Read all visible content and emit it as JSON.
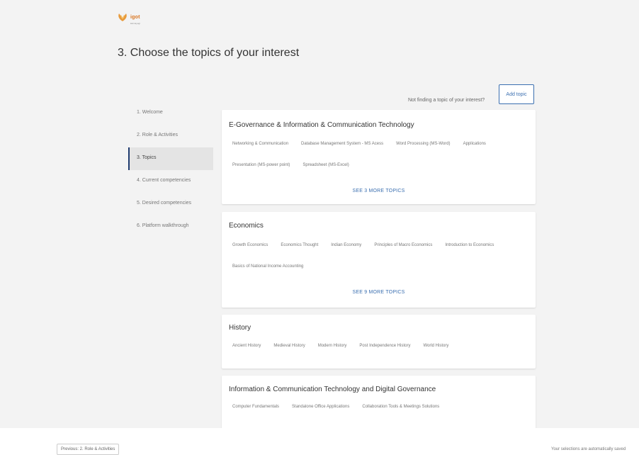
{
  "header": {
    "logo_text": "igot",
    "logo_subtext": "karmayogi"
  },
  "page_title": "3. Choose the topics of your interest",
  "not_finding_text": "Not finding a topic of your interest?",
  "add_topic_label": "Add topic",
  "steps": [
    {
      "label": "1. Welcome"
    },
    {
      "label": "2. Role & Activities"
    },
    {
      "label": "3. Topics",
      "active": true
    },
    {
      "label": "4. Current competencies"
    },
    {
      "label": "5. Desired competencies"
    },
    {
      "label": "6. Platform walkthrough"
    }
  ],
  "cards": [
    {
      "title": "E-Governance & Information & Communication Technology",
      "topics": [
        "Networking & Communication",
        "Database Management System - MS Acess",
        "Word Processing (MS-Word)",
        "Applications",
        "Presentation (MS-power point)",
        "Spreadsheet (MS-Excel)"
      ],
      "see_more": "SEE 3 MORE TOPICS"
    },
    {
      "title": "Economics",
      "topics": [
        "Growth Economics",
        "Economics Thought",
        "Indian Economy",
        "Principles of Macro Economics",
        "Introduction to Economics",
        "Basics of National Income Accounting"
      ],
      "see_more": "SEE 9 MORE TOPICS"
    },
    {
      "title": "History",
      "topics": [
        "Ancient History",
        "Medieval History",
        "Modern History",
        "Post Independence History",
        "World History"
      ]
    },
    {
      "title": "Information & Communication Technology and Digital Governance",
      "topics": [
        "Computer Fundamentals",
        "Standalone Office Applications",
        "Collaboration Tools & Meetings Solutions"
      ]
    }
  ],
  "footer": {
    "previous_label": "Previous: 2. Role & Activities",
    "autosave_text": "Your selections are automatically saved"
  },
  "colors": {
    "accent": "#3b6fb0",
    "active_step_border": "#1e3a6e",
    "logo_orange": "#d9731c",
    "background": "#f3f3f3"
  }
}
